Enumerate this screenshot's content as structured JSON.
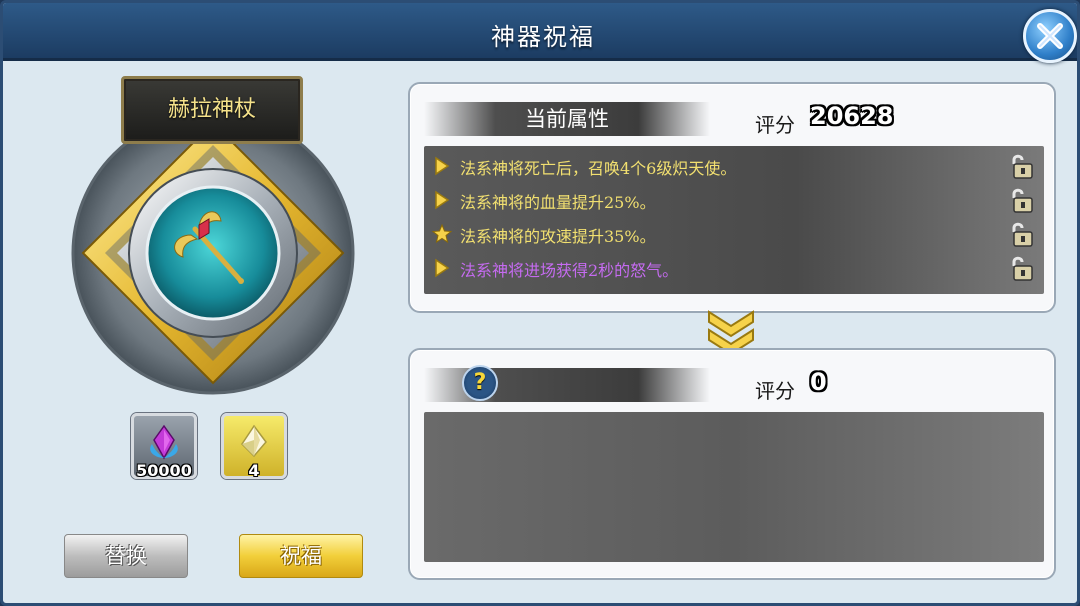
{
  "window": {
    "title": "神器祝福"
  },
  "artifact": {
    "name": "赫拉神杖"
  },
  "materials": [
    {
      "icon": "purple-gem-icon",
      "count": "50000"
    },
    {
      "icon": "crystal-icon",
      "count": "4"
    }
  ],
  "buttons": {
    "replace": "替换",
    "bless": "祝福"
  },
  "current": {
    "header": "当前属性",
    "score_label": "评分",
    "score": "20628",
    "attributes": [
      {
        "text": "法系神将死亡后，召唤4个6级炽天使。",
        "color": "#f2e070",
        "bullet": "triangle-icon"
      },
      {
        "text": "法系神将的血量提升25%。",
        "color": "#f2e070",
        "bullet": "triangle-icon"
      },
      {
        "text": "法系神将的攻速提升35%。",
        "color": "#f2e070",
        "bullet": "star-icon"
      },
      {
        "text": "法系神将进场获得2秒的怒气。",
        "color": "#c56bf0",
        "bullet": "triangle-icon"
      }
    ]
  },
  "next": {
    "header": "",
    "score_label": "评分",
    "score": "0"
  },
  "colors": {
    "accent_gold": "#f2cf3a",
    "frame_blue": "#2c4d74"
  }
}
